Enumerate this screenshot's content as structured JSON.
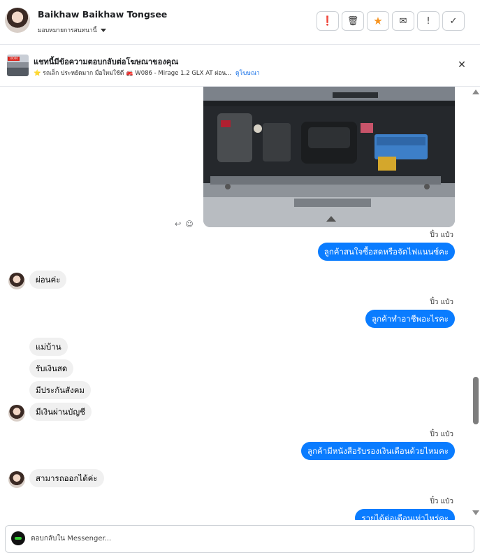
{
  "header": {
    "contact_name": "Baikhaw Baikhaw Tongsee",
    "assign_label": "มอบหมายการสนทนานี้",
    "actions": [
      {
        "name": "mark-spam-button",
        "icon": "alert-circle-icon",
        "glyph": "❗"
      },
      {
        "name": "delete-button",
        "icon": "trash-icon",
        "glyph": "🗑"
      },
      {
        "name": "star-button",
        "icon": "star-icon",
        "glyph": "★",
        "color": "#f7931e"
      },
      {
        "name": "mark-unread-button",
        "icon": "envelope-icon",
        "glyph": "✉"
      },
      {
        "name": "follow-up-button",
        "icon": "exclamation-icon",
        "glyph": "!"
      },
      {
        "name": "mark-done-button",
        "icon": "check-icon",
        "glyph": "✓"
      }
    ]
  },
  "ad_banner": {
    "title": "แชทนี้มีข้อความตอบกลับต่อโฆษณาของคุณ",
    "subtitle": "⭐ รถเล็ก ประหยัดมาก มือใหม่ใช้ดี 🚒 W086 - Mirage 1.2 GLX AT ผ่อน...",
    "link": "ดูโฆษณา",
    "thumb_tag": "10000",
    "close_glyph": "✕"
  },
  "conversation": {
    "reply_icon": "↩",
    "react_icon": "☺",
    "messages": [
      {
        "dir": "out",
        "time": "ปิ๋ว แป๋ว",
        "text": "ลูกค้าสนใจซื้อสดหรือจัดไฟแนนซ์คะ"
      },
      {
        "dir": "in",
        "text": "ผ่อนค่ะ"
      },
      {
        "dir": "out",
        "time": "ปิ๋ว แป๋ว",
        "text": "ลูกค้าทำอาชีพอะไรคะ"
      },
      {
        "dir": "in",
        "text": "แม่บ้าน"
      },
      {
        "dir": "in",
        "text": "รับเงินสด"
      },
      {
        "dir": "in",
        "text": "มีประกันสังคม"
      },
      {
        "dir": "in",
        "text": "มีเงินผ่านบัญชี"
      },
      {
        "dir": "out",
        "time": "ปิ๋ว แป๋ว",
        "text": "ลูกค้ามีหนังสือรับรองเงินเดือนด้วยไหมคะ"
      },
      {
        "dir": "in",
        "text": "สามารถออกได้ค่ะ"
      },
      {
        "dir": "out",
        "time": "ปิ๋ว แป๋ว",
        "text": "รายได้ต่อเดือนเท่าไหร่คะ"
      }
    ]
  },
  "composer": {
    "placeholder": "ตอบกลับใน Messenger..."
  },
  "colors": {
    "outgoing_bubble": "#0a7cff",
    "incoming_bubble": "#f0f0f0",
    "link": "#1a73e8"
  }
}
